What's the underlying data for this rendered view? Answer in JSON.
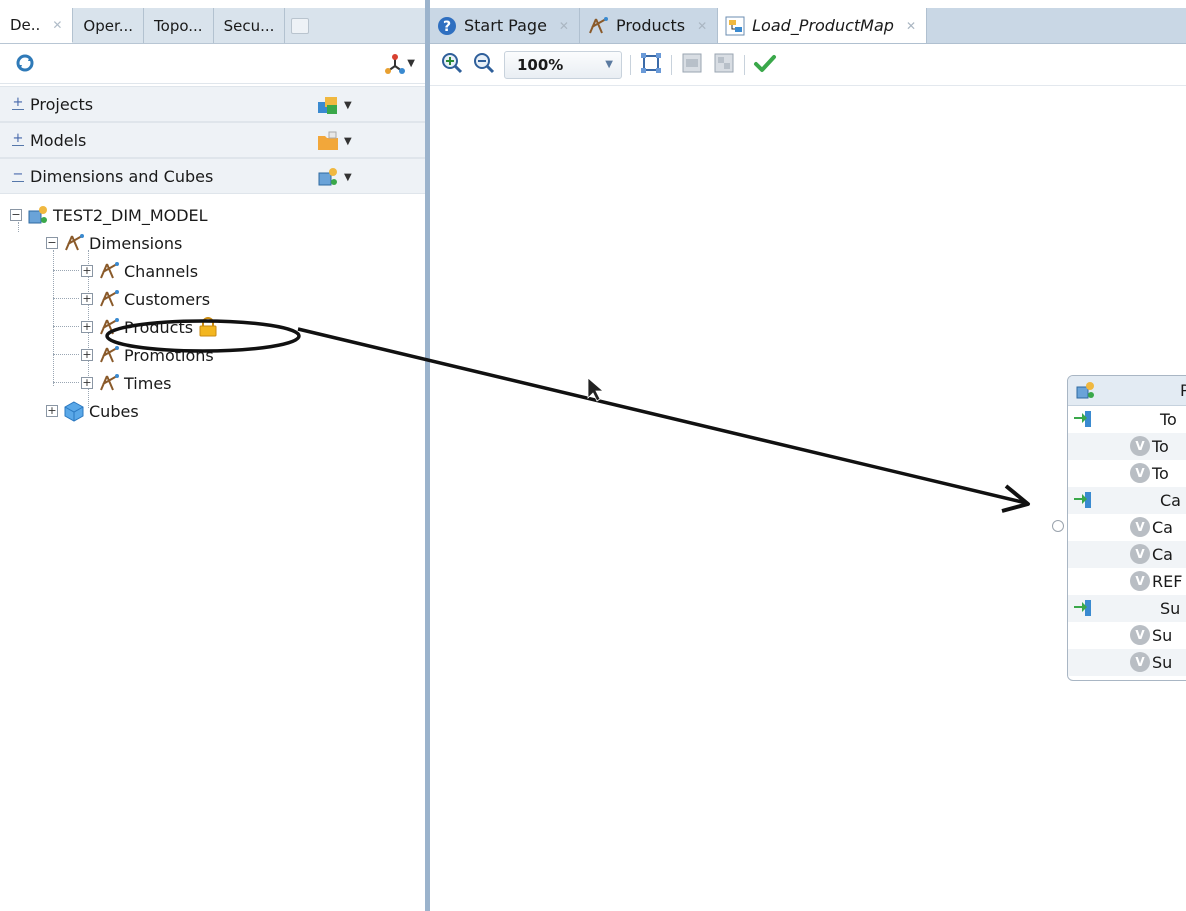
{
  "left_tabs": [
    {
      "label": "De..",
      "active": true
    },
    {
      "label": "Oper..."
    },
    {
      "label": "Topo..."
    },
    {
      "label": "Secu..."
    }
  ],
  "accordions": {
    "projects": {
      "sign": "+",
      "label": "Projects"
    },
    "models": {
      "sign": "+",
      "label": "Models"
    },
    "dimensions": {
      "sign": "−",
      "label": "Dimensions and Cubes"
    }
  },
  "tree": {
    "root": "TEST2_DIM_MODEL",
    "dimensions": "Dimensions",
    "items": [
      "Channels",
      "Customers",
      "Products",
      "Promotions",
      "Times"
    ],
    "cubes": "Cubes"
  },
  "right_tabs": [
    {
      "label": "Start Page"
    },
    {
      "label": "Products"
    },
    {
      "label": "Load_ProductMap",
      "active": true
    }
  ],
  "toolbar": {
    "zoom": "100%"
  },
  "dim_box": {
    "title": "P",
    "rows": [
      {
        "label": "To",
        "kind": "key"
      },
      {
        "label": "To",
        "kind": "v"
      },
      {
        "label": "To",
        "kind": "v"
      },
      {
        "label": "Ca",
        "kind": "key"
      },
      {
        "label": "Ca",
        "kind": "v"
      },
      {
        "label": "Ca",
        "kind": "v"
      },
      {
        "label": "REF",
        "kind": "v"
      },
      {
        "label": "Su",
        "kind": "key"
      },
      {
        "label": "Su",
        "kind": "v"
      },
      {
        "label": "Su",
        "kind": "v"
      }
    ]
  },
  "colors": {
    "splitter": "#9bb3cc",
    "accent_green": "#3aa84a",
    "tab_bar": "#c9d7e5"
  }
}
